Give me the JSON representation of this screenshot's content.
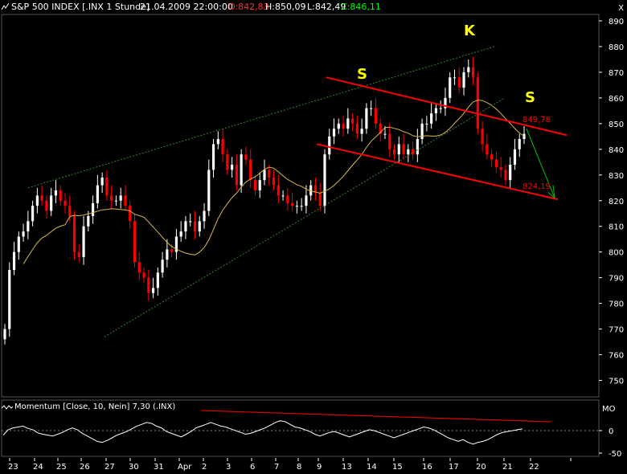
{
  "header": {
    "symbol": "S&P 500 INDEX [.INX  1 Stunde]",
    "datetime": "21.04.2009 22:00:00",
    "open": "O:842,83",
    "high": "H:850,09",
    "low": "L:842,49",
    "close": "C:846,11",
    "close_icon": "X"
  },
  "colors": {
    "background": "#000000",
    "up_candle": "#ffffff",
    "down_candle": "#ff0000",
    "open_text": "#ff3030",
    "close_text": "#00ff00",
    "ma_line": "#d9b84a",
    "channel": "#ff0000",
    "wedge": "#2c8a2c",
    "arrow": "#00c000",
    "annotation": "#ffff00",
    "grid": "#2a2a2a"
  },
  "chart_data": [
    {
      "type": "candlestick",
      "title": "S&P 500 INDEX [.INX  1 Stunde] 21.04.2009 22:00:00",
      "ylim": [
        745,
        892
      ],
      "yticks": [
        750,
        760,
        770,
        780,
        790,
        800,
        810,
        820,
        830,
        840,
        850,
        860,
        870,
        880,
        890
      ],
      "xticks": [
        "23",
        "24",
        "25",
        "26",
        "27",
        "30",
        "31",
        "Apr",
        "2",
        "3",
        "6",
        "7",
        "8",
        "9",
        "13",
        "14",
        "15",
        "16",
        "17",
        "20",
        "21",
        "22"
      ],
      "closes": [
        770,
        793,
        800,
        806,
        808,
        812,
        818,
        822,
        820,
        816,
        822,
        824,
        820,
        818,
        814,
        800,
        798,
        810,
        814,
        819,
        826,
        829,
        822,
        820,
        820,
        822,
        818,
        812,
        796,
        792,
        790,
        784,
        786,
        792,
        797,
        801,
        800,
        806,
        808,
        812,
        812,
        808,
        812,
        816,
        832,
        842,
        844,
        838,
        832,
        834,
        826,
        838,
        836,
        828,
        824,
        828,
        832,
        829,
        826,
        822,
        822,
        819,
        818,
        818,
        818,
        822,
        826,
        823,
        818,
        838,
        845,
        848,
        850,
        848,
        852,
        850,
        846,
        848,
        856,
        856,
        850,
        846,
        846,
        840,
        838,
        842,
        838,
        840,
        838,
        844,
        850,
        850,
        854,
        856,
        856,
        860,
        868,
        868,
        864,
        870,
        872,
        868,
        848,
        842,
        838,
        836,
        833,
        832,
        828,
        834,
        840,
        844,
        846
      ],
      "ma_line": "moving average (yellow)",
      "annotations": [
        {
          "text": "S",
          "note": "left shoulder"
        },
        {
          "text": "K",
          "note": "head"
        },
        {
          "text": "S",
          "note": "right shoulder"
        },
        {
          "text": "849,78",
          "value": 849.78
        },
        {
          "text": "824,19",
          "value": 824.19
        }
      ],
      "grid": false
    },
    {
      "type": "line",
      "title": "Momentum [Close, 10, Nein] 7,30 (.INX)",
      "ylabel": "MO",
      "yticks": [
        0,
        -50
      ],
      "ylim": [
        -60,
        30
      ],
      "values": [
        -10,
        2,
        6,
        8,
        10,
        5,
        2,
        -5,
        -8,
        -10,
        -12,
        -8,
        -4,
        2,
        6,
        2,
        -6,
        -12,
        -18,
        -24,
        -26,
        -22,
        -16,
        -10,
        -6,
        -2,
        4,
        10,
        14,
        18,
        16,
        10,
        6,
        -2,
        -6,
        -10,
        -14,
        -8,
        -2,
        6,
        10,
        14,
        18,
        14,
        10,
        8,
        4,
        0,
        -4,
        -8,
        -6,
        -2,
        2,
        6,
        12,
        18,
        22,
        20,
        14,
        8,
        6,
        2,
        -2,
        -8,
        -12,
        -8,
        -4,
        -2,
        -6,
        -10,
        -14,
        -10,
        -6,
        -2,
        2,
        0,
        -4,
        -8,
        -12,
        -16,
        -12,
        -8,
        -4,
        0,
        4,
        8,
        6,
        2,
        -4,
        -10,
        -16,
        -20,
        -24,
        -20,
        -26,
        -30,
        -26,
        -24,
        -20,
        -14,
        -8,
        -4,
        -2,
        0,
        2,
        4
      ]
    }
  ]
}
